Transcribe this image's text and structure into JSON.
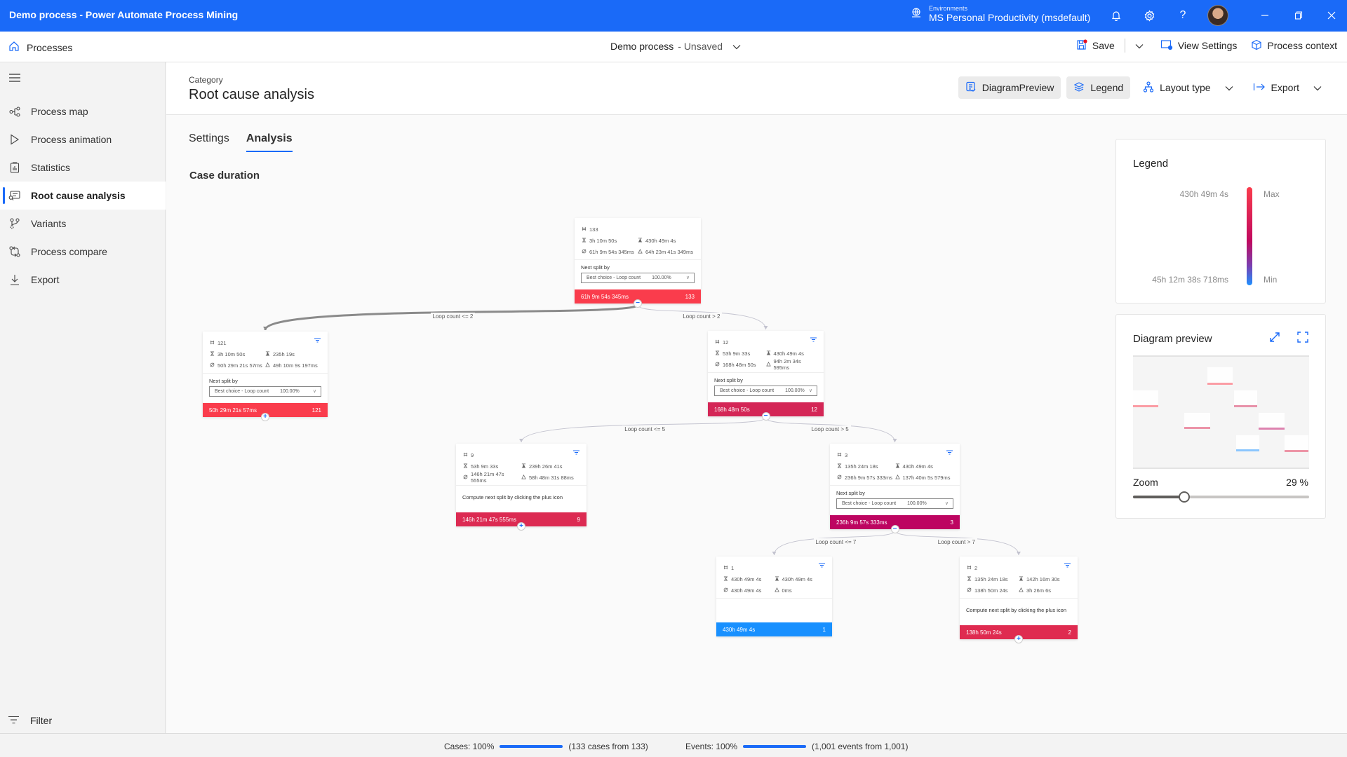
{
  "titlebar": {
    "title": "Demo process - Power Automate Process Mining",
    "environment_label": "Environments",
    "environment_name": "MS Personal Productivity (msdefault)",
    "icons": [
      "globe-icon",
      "bell-icon",
      "gear-icon",
      "help-icon",
      "avatar",
      "minimize-icon",
      "restore-icon",
      "close-icon"
    ]
  },
  "commandbar": {
    "processes_label": "Processes",
    "document_title": "Demo process",
    "document_state": "- Unsaved",
    "save_label": "Save",
    "view_settings_label": "View Settings",
    "process_context_label": "Process context"
  },
  "sidebar": {
    "items": [
      {
        "label": "Process map",
        "icon": "process-map-icon",
        "active": false
      },
      {
        "label": "Process animation",
        "icon": "play-icon",
        "active": false
      },
      {
        "label": "Statistics",
        "icon": "clipboard-chart-icon",
        "active": false
      },
      {
        "label": "Root cause analysis",
        "icon": "root-cause-icon",
        "active": true
      },
      {
        "label": "Variants",
        "icon": "variants-icon",
        "active": false
      },
      {
        "label": "Process compare",
        "icon": "compare-icon",
        "active": false
      },
      {
        "label": "Export",
        "icon": "download-icon",
        "active": false
      }
    ],
    "filter_label": "Filter"
  },
  "page": {
    "category": "Category",
    "title": "Root cause analysis",
    "tools": {
      "diagram_preview": "DiagramPreview",
      "legend": "Legend",
      "layout_type": "Layout type",
      "export": "Export"
    },
    "tabs": [
      {
        "label": "Settings",
        "active": false
      },
      {
        "label": "Analysis",
        "active": true
      }
    ],
    "section_title": "Case duration"
  },
  "tree": {
    "split_label": "Next split by",
    "split_value": "Best choice - Loop count",
    "split_percent": "100.00%",
    "compute_hint": "Compute next split by clicking the plus icon",
    "nodes": [
      {
        "id": "n133",
        "cases": "133",
        "min": "3h 10m 50s",
        "max": "430h 49m 4s",
        "avg": "61h 9m 54s 345ms",
        "std": "64h 23m 41s 349ms",
        "bar_value": "61h 9m 54s 345ms",
        "bar_count": "133",
        "color": "#fa3c4c",
        "mode": "split",
        "toggle": "minus"
      },
      {
        "id": "n121",
        "cases": "121",
        "min": "3h 10m 50s",
        "max": "235h 19s",
        "avg": "50h 29m 21s 57ms",
        "std": "49h 10m 9s 197ms",
        "bar_value": "50h 29m 21s 57ms",
        "bar_count": "121",
        "color": "#fa3c4c",
        "mode": "split",
        "toggle": "plus"
      },
      {
        "id": "n12",
        "cases": "12",
        "min": "53h 9m 33s",
        "max": "430h 49m 4s",
        "avg": "168h 48m 50s",
        "std": "94h 2m 34s 595ms",
        "bar_value": "168h 48m 50s",
        "bar_count": "12",
        "color": "#d42656",
        "mode": "split",
        "toggle": "minus"
      },
      {
        "id": "n9",
        "cases": "9",
        "min": "53h 9m 33s",
        "max": "239h 26m 41s",
        "avg": "146h 21m 47s 555ms",
        "std": "58h 48m 31s 88ms",
        "bar_value": "146h 21m 47s 555ms",
        "bar_count": "9",
        "color": "#dc2a52",
        "mode": "compute",
        "toggle": "plus"
      },
      {
        "id": "n3",
        "cases": "3",
        "min": "135h 24m 18s",
        "max": "430h 49m 4s",
        "avg": "236h 9m 57s 333ms",
        "std": "137h 40m 5s 579ms",
        "bar_value": "236h 9m 57s 333ms",
        "bar_count": "3",
        "color": "#bd0561",
        "mode": "split",
        "toggle": "minus"
      },
      {
        "id": "n1",
        "cases": "1",
        "min": "430h 49m 4s",
        "max": "430h 49m 4s",
        "avg": "430h 49m 4s",
        "std": "0ms",
        "bar_value": "430h 49m 4s",
        "bar_count": "1",
        "color": "#1890ff",
        "mode": "leaf",
        "toggle": "none"
      },
      {
        "id": "n2",
        "cases": "2",
        "min": "135h 24m 18s",
        "max": "142h 16m 30s",
        "avg": "138h 50m 24s",
        "std": "3h 26m 6s",
        "bar_value": "138h 50m 24s",
        "bar_count": "2",
        "color": "#df2b50",
        "mode": "compute",
        "toggle": "plus"
      }
    ],
    "edges": [
      {
        "from": "n133",
        "to": "n121",
        "label": "Loop count <= 2"
      },
      {
        "from": "n133",
        "to": "n12",
        "label": "Loop count > 2"
      },
      {
        "from": "n12",
        "to": "n9",
        "label": "Loop count <= 5"
      },
      {
        "from": "n12",
        "to": "n3",
        "label": "Loop count > 5"
      },
      {
        "from": "n3",
        "to": "n1",
        "label": "Loop count <= 7"
      },
      {
        "from": "n3",
        "to": "n2",
        "label": "Loop count > 7"
      }
    ]
  },
  "legend": {
    "title": "Legend",
    "max_value": "430h 49m 4s",
    "max_label": "Max",
    "min_value": "45h 12m 38s 718ms",
    "min_label": "Min",
    "colors": {
      "max": "#fa3c4c",
      "mid": "#c0095f",
      "min": "#1e90ff"
    }
  },
  "preview": {
    "title": "Diagram preview",
    "zoom_label": "Zoom",
    "zoom_value": "29 %",
    "zoom_fraction": 0.29
  },
  "status": {
    "cases_label": "Cases: 100%",
    "cases_fraction": 1.0,
    "cases_detail": "(133 cases from 133)",
    "events_label": "Events: 100%",
    "events_fraction": 1.0,
    "events_detail": "(1,001 events from 1,001)"
  }
}
